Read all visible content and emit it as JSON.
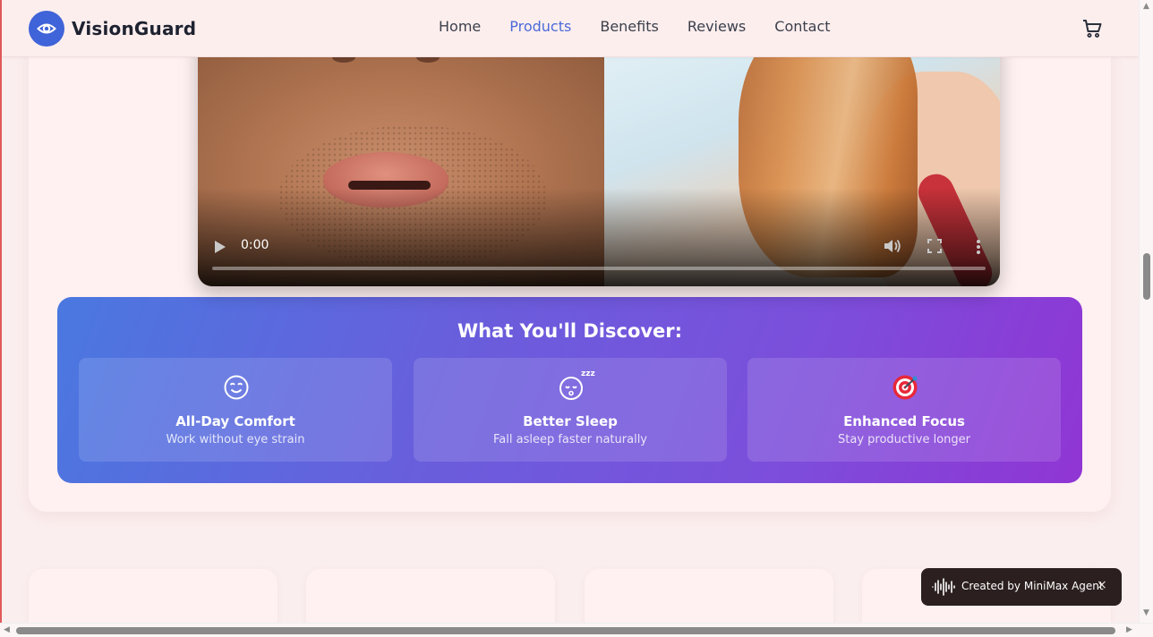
{
  "brand": {
    "name": "VisionGuard",
    "icon": "eye-icon",
    "accent": "#3f63d8"
  },
  "nav": {
    "items": [
      {
        "label": "Home",
        "active": false
      },
      {
        "label": "Products",
        "active": true
      },
      {
        "label": "Benefits",
        "active": false
      },
      {
        "label": "Reviews",
        "active": false
      },
      {
        "label": "Contact",
        "active": false
      }
    ],
    "active_color": "#4a6ad8",
    "cart_icon": "shopping-cart-icon"
  },
  "video": {
    "time": "0:00",
    "progress": 0,
    "controls": [
      "play-icon",
      "volume-icon",
      "fullscreen-icon",
      "more-options-icon"
    ]
  },
  "discover": {
    "title": "What You'll Discover:",
    "gradient": [
      "#4a78e0",
      "#9035d4"
    ],
    "items": [
      {
        "icon": "relieved-face-icon",
        "title": "All-Day Comfort",
        "subtitle": "Work without eye strain"
      },
      {
        "icon": "sleeping-face-icon",
        "title": "Better Sleep",
        "subtitle": "Fall asleep faster naturally"
      },
      {
        "icon": "target-icon",
        "title": "Enhanced Focus",
        "subtitle": "Stay productive longer"
      }
    ]
  },
  "toast": {
    "icon": "waveform-icon",
    "text": "Created by MiniMax Agent",
    "close": "×"
  }
}
